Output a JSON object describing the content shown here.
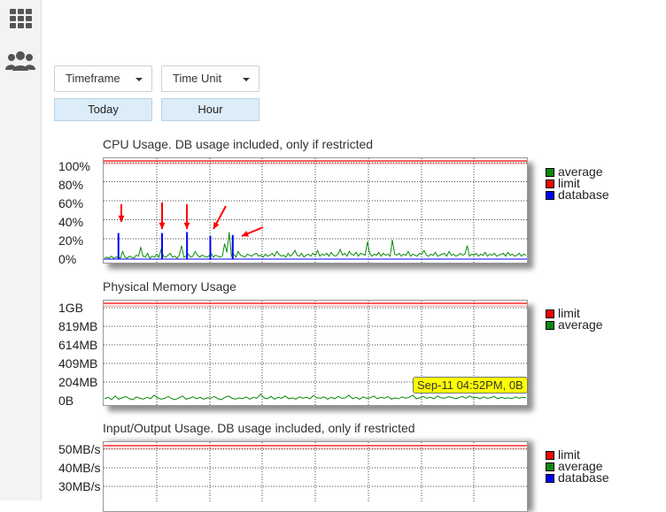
{
  "sidebar": {
    "icons": [
      "grid-icon",
      "users-icon"
    ]
  },
  "controls": {
    "timeframe_label": "Timeframe",
    "time_unit_label": "Time Unit",
    "timeframe_value": "Today",
    "time_unit_value": "Hour"
  },
  "colors": {
    "average": "#0a8a0a",
    "limit": "#ff0000",
    "database": "#0000ff",
    "tooltip_bg": "#ffff00",
    "button_selected": "#dcecf8"
  },
  "charts": {
    "cpu": {
      "title": "CPU Usage. DB usage included, only if restricted",
      "yticks": [
        "100%",
        "80%",
        "60%",
        "40%",
        "20%",
        "0%"
      ],
      "legend": [
        {
          "label": "average",
          "color": "#0a8a0a"
        },
        {
          "label": "limit",
          "color": "#ff0000"
        },
        {
          "label": "database",
          "color": "#0000ff"
        }
      ]
    },
    "memory": {
      "title": "Physical Memory Usage",
      "yticks": [
        "1GB",
        "819MB",
        "614MB",
        "409MB",
        "204MB",
        "0B"
      ],
      "legend": [
        {
          "label": "limit",
          "color": "#ff0000"
        },
        {
          "label": "average",
          "color": "#0a8a0a"
        }
      ],
      "tooltip": "Sep-11 04:52PM, 0B"
    },
    "io": {
      "title": "Input/Output Usage. DB usage included, only if restricted",
      "yticks": [
        "50MB/s",
        "40MB/s",
        "30MB/s"
      ],
      "legend": [
        {
          "label": "limit",
          "color": "#ff0000"
        },
        {
          "label": "average",
          "color": "#0a8a0a"
        },
        {
          "label": "database",
          "color": "#0000ff"
        }
      ]
    }
  },
  "chart_data": [
    {
      "type": "line",
      "title": "CPU Usage. DB usage included, only if restricted",
      "ylim": [
        0,
        100
      ],
      "y_unit": "%",
      "grid": true,
      "legend_position": "right",
      "series": [
        {
          "name": "average",
          "color": "#0a8a0a",
          "values": [
            1,
            2,
            1,
            3,
            1,
            2,
            2,
            1,
            8,
            2,
            1,
            3,
            2,
            1,
            4,
            3,
            12,
            3,
            2,
            6,
            1,
            3,
            2,
            5,
            2,
            10,
            3,
            2,
            4,
            6,
            2,
            3,
            1,
            4,
            14,
            2,
            3,
            5,
            2,
            3,
            8,
            4,
            2,
            4,
            3,
            2,
            3,
            6,
            2,
            4,
            3,
            2,
            3,
            16,
            7,
            28,
            3,
            5,
            2,
            8,
            4,
            3,
            2,
            5,
            4,
            3,
            5,
            6,
            3,
            4,
            2,
            5,
            3,
            4,
            6,
            3,
            8,
            5,
            3,
            4,
            2,
            6,
            3,
            5,
            9,
            4,
            3,
            6,
            2,
            4,
            5,
            3,
            6,
            4,
            9,
            3,
            5,
            4,
            6,
            3,
            7,
            4,
            3,
            5,
            10,
            4,
            6,
            3,
            8,
            5,
            4,
            7,
            3,
            6,
            5,
            4,
            18,
            6,
            3,
            5,
            4,
            7,
            3,
            6,
            4,
            5,
            3,
            20,
            5,
            4,
            6,
            3,
            5,
            4,
            8,
            3,
            5,
            4,
            3,
            6,
            5,
            9,
            4,
            3,
            5,
            4,
            7,
            3,
            4,
            5,
            6,
            3,
            8,
            4,
            5,
            3,
            4,
            6,
            4,
            5,
            14,
            3,
            5,
            4,
            6,
            3,
            5,
            4,
            7,
            3,
            5,
            4,
            6,
            3,
            4,
            5,
            6,
            3,
            7,
            4,
            5,
            3,
            4,
            6,
            3,
            5,
            4
          ]
        },
        {
          "name": "limit",
          "color": "#ff0000",
          "values": [
            100
          ]
        },
        {
          "name": "database",
          "color": "#0000ff",
          "spikes": [
            {
              "x_fraction": 0.035,
              "value": 27
            },
            {
              "x_fraction": 0.138,
              "value": 27
            },
            {
              "x_fraction": 0.197,
              "value": 28
            },
            {
              "x_fraction": 0.252,
              "value": 24
            },
            {
              "x_fraction": 0.305,
              "value": 25
            }
          ]
        }
      ]
    },
    {
      "type": "line",
      "title": "Physical Memory Usage",
      "ylim": [
        0,
        1024
      ],
      "y_unit": "MB",
      "grid": true,
      "legend_position": "right",
      "series": [
        {
          "name": "limit",
          "color": "#ff0000",
          "values": [
            1024
          ]
        },
        {
          "name": "average",
          "color": "#0a8a0a",
          "values": [
            30,
            45,
            20,
            60,
            25,
            40,
            55,
            30,
            20,
            50,
            35,
            25,
            45,
            30,
            70,
            40,
            25,
            35,
            55,
            30,
            20,
            40,
            60,
            25,
            35,
            50,
            30,
            45,
            25,
            40,
            35,
            55,
            30,
            20,
            45,
            60,
            35,
            25,
            40,
            30,
            50,
            25,
            45,
            35,
            80,
            40,
            30,
            55,
            25,
            45,
            35,
            60,
            30,
            40,
            25,
            50,
            35,
            45,
            30,
            65,
            40,
            35,
            50,
            25,
            45,
            30,
            55,
            35,
            40,
            70,
            30,
            45,
            25,
            50,
            35,
            40,
            60,
            30,
            45,
            35,
            55,
            25,
            40,
            30,
            50,
            35,
            45,
            70,
            30,
            40,
            55,
            35,
            45,
            30,
            60,
            40,
            35,
            50,
            45,
            30,
            40,
            55,
            35,
            60,
            40,
            45,
            30,
            50,
            35,
            40,
            55,
            30,
            45,
            35,
            40,
            30,
            50,
            35,
            45,
            40
          ]
        }
      ]
    },
    {
      "type": "line",
      "title": "Input/Output Usage. DB usage included, only if restricted",
      "ylim": [
        0,
        50
      ],
      "y_unit": "MB/s",
      "grid": true,
      "legend_position": "right",
      "series": [
        {
          "name": "limit",
          "color": "#ff0000",
          "values": [
            50
          ]
        },
        {
          "name": "average",
          "color": "#0a8a0a",
          "values": []
        },
        {
          "name": "database",
          "color": "#0000ff",
          "values": []
        }
      ]
    }
  ]
}
